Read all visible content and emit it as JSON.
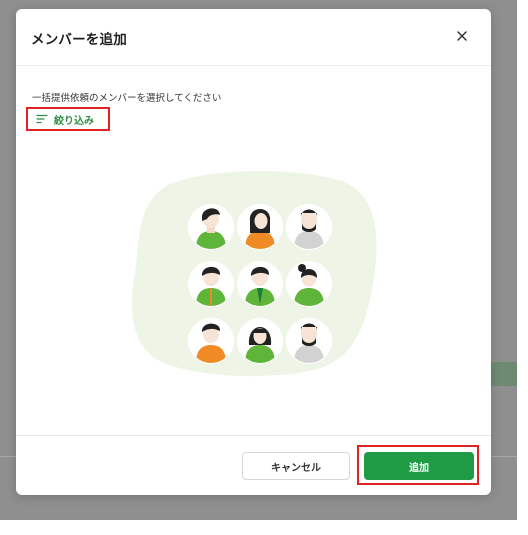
{
  "dialog": {
    "title": "メンバーを追加",
    "instruction": "一括提供依頼のメンバーを選択してください",
    "filter_label": "絞り込み",
    "cancel_label": "キャンセル",
    "add_label": "追加"
  },
  "colors": {
    "accent_green": "#1f9b45",
    "filter_green": "#2f8a45",
    "highlight_red": "#e02424",
    "illustration_bg": "#eef5e6"
  },
  "icons": {
    "close": "close-icon",
    "filter": "filter-lines-icon"
  }
}
